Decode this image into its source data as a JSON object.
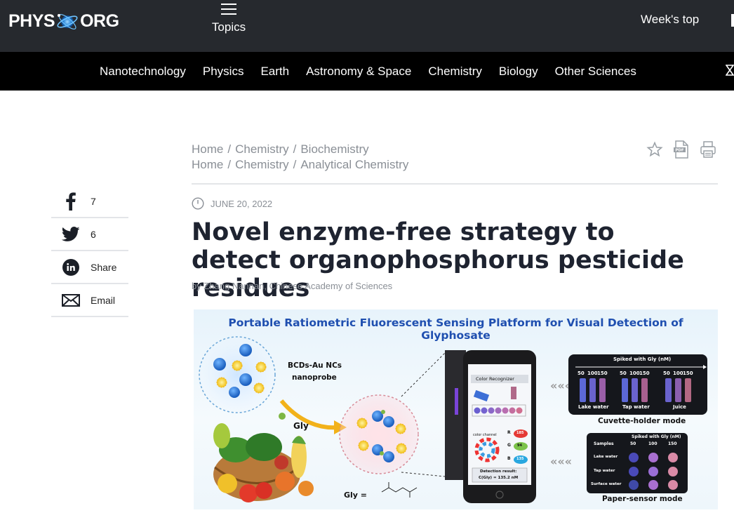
{
  "header": {
    "logo_left": "PHYS",
    "logo_right": "ORG",
    "topics_label": "Topics",
    "weeks_top": "Week's top"
  },
  "categories": [
    "Nanotechnology",
    "Physics",
    "Earth",
    "Astronomy & Space",
    "Chemistry",
    "Biology",
    "Other Sciences"
  ],
  "breadcrumbs": [
    [
      "Home",
      "Chemistry",
      "Biochemistry"
    ],
    [
      "Home",
      "Chemistry",
      "Analytical Chemistry"
    ]
  ],
  "breadcrumb_separator": "/",
  "share": [
    {
      "icon": "facebook-icon",
      "label": "7"
    },
    {
      "icon": "twitter-icon",
      "label": "6"
    },
    {
      "icon": "linkedin-icon",
      "label": "Share"
    },
    {
      "icon": "email-icon",
      "label": "Email"
    }
  ],
  "article": {
    "date": "JUNE 20, 2022",
    "title": "Novel enzyme-free strategy to detect organophosphorus pesticide residues",
    "byline": "by Zhang Nannan, Chinese Academy of Sciences"
  },
  "figure": {
    "title": "Portable Ratiometric Fluorescent Sensing Platform for Visual Detection of Glyphosate",
    "probe_label_1": "BCDs-Au NCs",
    "probe_label_2": "nanoprobe",
    "gly_label": "Gly",
    "gly_formula": "Gly =",
    "phone_header": "Color Recognizer",
    "phone_r": "R",
    "phone_g": "G",
    "phone_b": "B",
    "phone_r_val": "185",
    "phone_g_val": "94",
    "phone_b_val": "135",
    "phone_color_channel": "color channel",
    "phone_result_1": "Detection result:",
    "phone_result_2": "C(Gly) = 135.2 nM",
    "cuvette_header": "Spiked with Gly (nM)",
    "cuvette_nums": [
      "50",
      "100",
      "150",
      "50",
      "100",
      "150",
      "50",
      "100",
      "150"
    ],
    "cuvette_samples": [
      "Lake water",
      "Tap water",
      "Juice"
    ],
    "cuvette_caption": "Cuvette-holder mode",
    "paper_header": "Spiked with Gly (nM)",
    "paper_samples_label": "Samples",
    "paper_cols": [
      "50",
      "100",
      "150"
    ],
    "paper_rows": [
      "Lake water",
      "Tap water",
      "Surface water"
    ],
    "paper_caption": "Paper-sensor mode",
    "colors": {
      "title_blue": "#1f4fb0",
      "nav_dark": "#26292e",
      "nav_black": "#000000",
      "arrow_yellow": "#f2b21a"
    }
  }
}
